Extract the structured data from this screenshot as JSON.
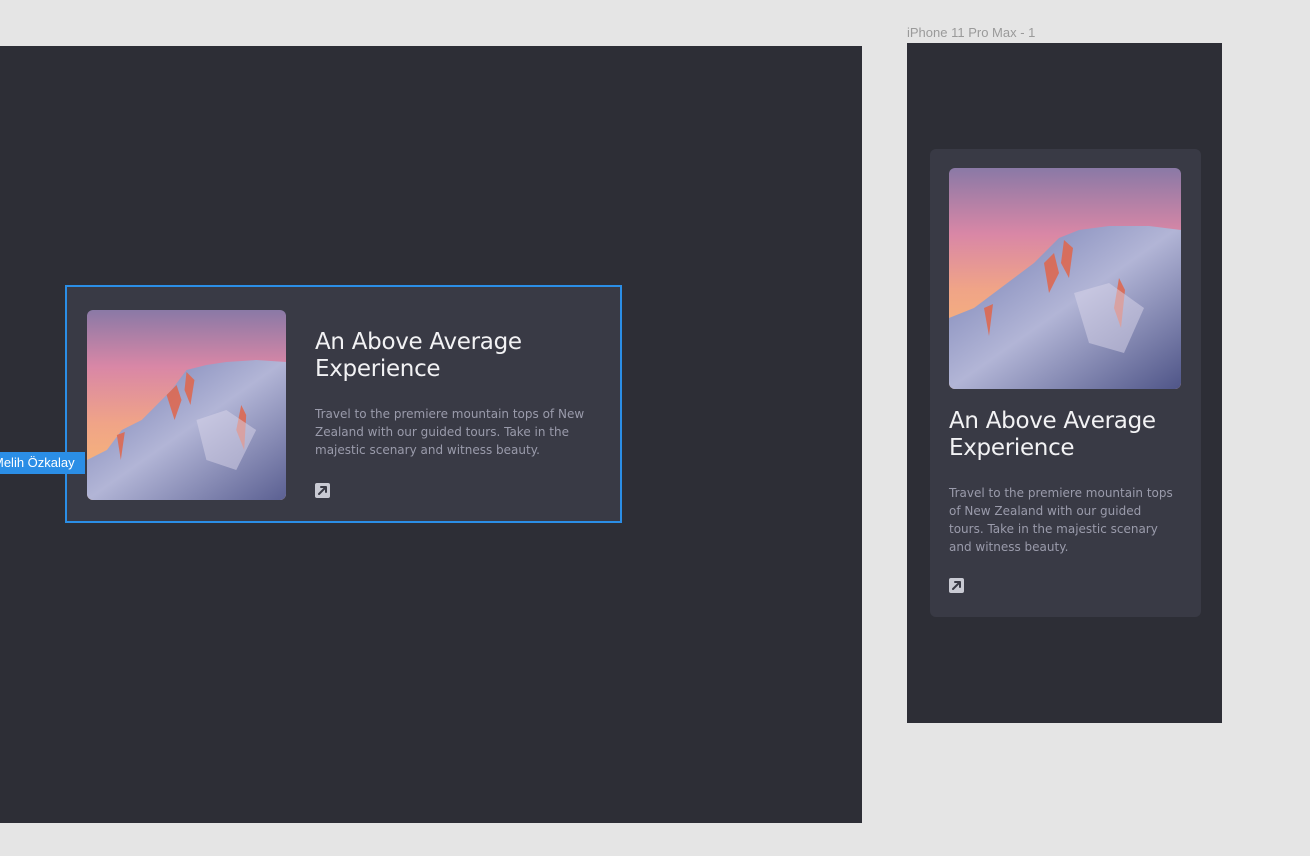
{
  "canvas": {
    "mobile_frame_label": "iPhone 11 Pro Max - 1",
    "collaborator_tag": "Melih Özkalay",
    "selection_color": "#2b8ee6",
    "frame_background": "#2d2e36",
    "card_background": "#393a45"
  },
  "card_desktop": {
    "image_alt": "snowy mountain peak at sunset",
    "title": "An Above Average Experience",
    "description": "Travel to the premiere mountain tops of New Zealand with our guided tours. Take in the majestic scenary and witness beauty.",
    "icon": "external-link-icon"
  },
  "card_mobile": {
    "image_alt": "snowy mountain peak at sunset",
    "title": "An Above Average Experience",
    "description": "Travel to the premiere mountain tops of New Zealand with our guided tours. Take in the majestic scenary and witness beauty.",
    "icon": "external-link-icon"
  }
}
